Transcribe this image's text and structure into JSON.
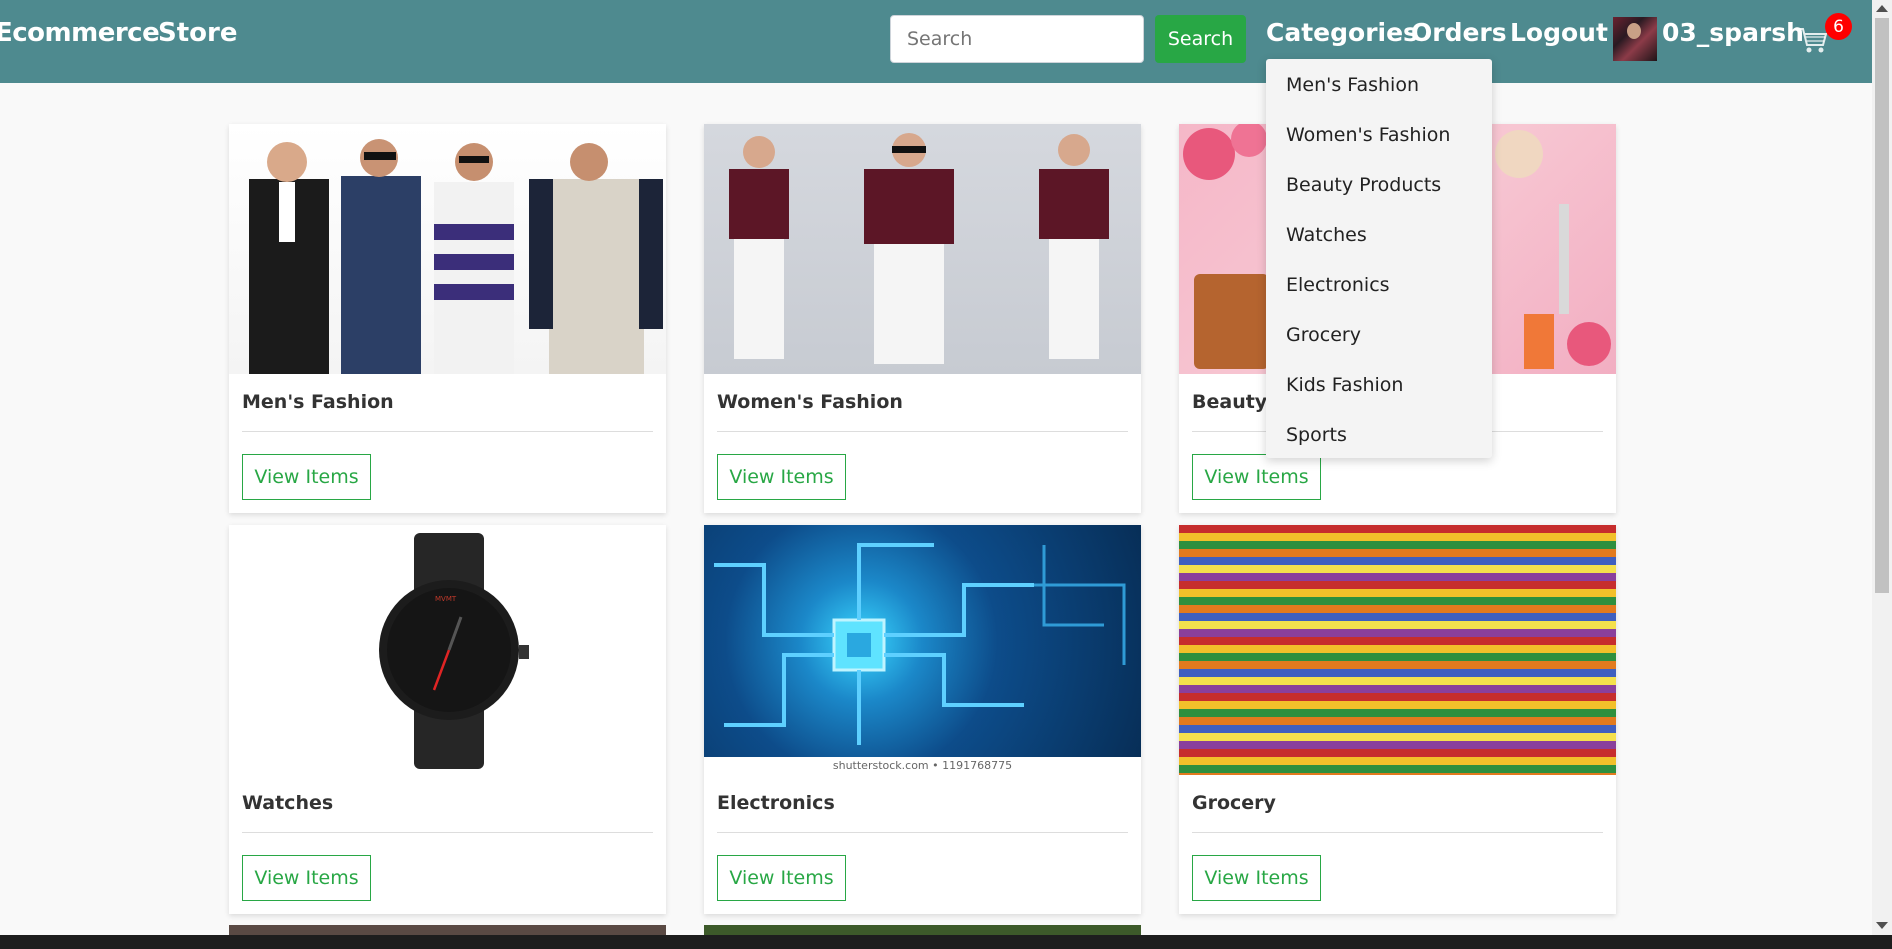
{
  "navbar": {
    "brand": "Ecommerce",
    "store": "Store",
    "search_placeholder": "Search",
    "search_button": "Search",
    "categories": "Categories",
    "orders": "Orders",
    "logout": "Logout",
    "username": "03_sparsh",
    "cart_count": "6"
  },
  "dropdown": {
    "items": [
      "Men's Fashion",
      "Women's Fashion",
      "Beauty Products",
      "Watches",
      "Electronics",
      "Grocery",
      "Kids Fashion",
      "Sports"
    ]
  },
  "cards": [
    {
      "title": "Men's Fashion",
      "button": "View Items"
    },
    {
      "title": "Women's Fashion",
      "button": "View Items"
    },
    {
      "title": "Beauty Products",
      "button": "View Items"
    },
    {
      "title": "Watches",
      "button": "View Items"
    },
    {
      "title": "Electronics",
      "button": "View Items"
    },
    {
      "title": "Grocery",
      "button": "View Items"
    }
  ],
  "image_captions": {
    "electronics_watermark": "shutterstock.com • 1191768775"
  },
  "colors": {
    "navbar": "#4e8a8f",
    "success": "#28a745",
    "badge": "#ff0000"
  }
}
